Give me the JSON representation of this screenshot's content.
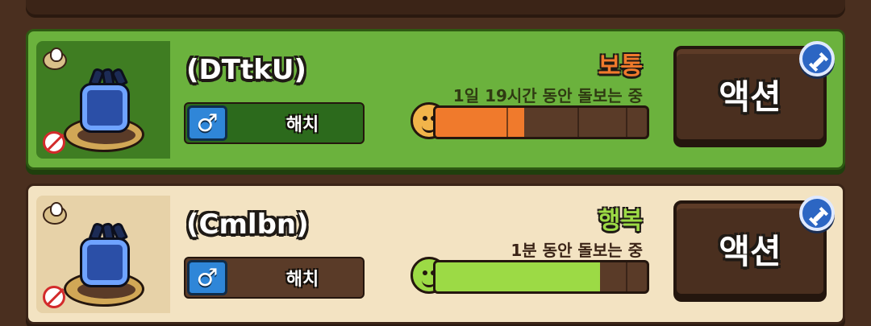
{
  "cards": [
    {
      "name": "(DTtkU)",
      "gender_symbol": "♂",
      "gender_status": "해치",
      "mood": "보통",
      "care_text": "1일 19시간 동안 돌보는 중",
      "progress": 0.42,
      "accent": "#f07a2c",
      "face_color": "#f2b44a",
      "action_label": "액션"
    },
    {
      "name": "(Cmlbn)",
      "gender_symbol": "♂",
      "gender_status": "해치",
      "mood": "행복",
      "care_text": "1분 동안 돌보는 중",
      "progress": 0.78,
      "accent": "#9cda45",
      "face_color": "#9cda45",
      "action_label": "액션"
    }
  ],
  "icons": {
    "egg": "egg-icon",
    "no": "no-pet-icon",
    "pet": "pet-sprite",
    "badge": "wrench-badge-icon",
    "gender": "male-icon",
    "face": "smile-face-icon"
  }
}
